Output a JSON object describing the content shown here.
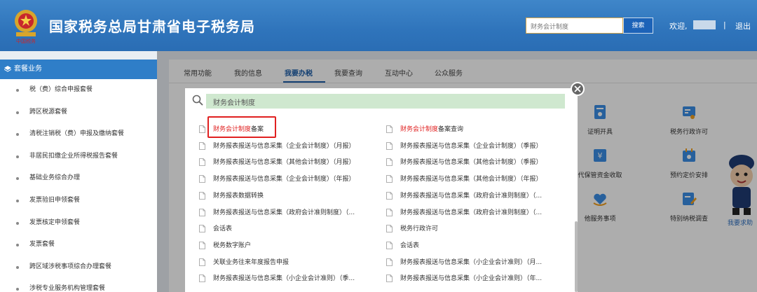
{
  "header": {
    "title": "国家税务总局甘肃省电子税务局",
    "emblem_text": "中国税务",
    "search_value": "财务会计制度",
    "search_button": "搜索",
    "welcome": "欢迎,",
    "separator": "|",
    "logout": "退出"
  },
  "sidebar": {
    "title": "套餐业务",
    "items": [
      "税（费）综合申报套餐",
      "跨区税源套餐",
      "清税注销税（费）申报及缴纳套餐",
      "非居民扣缴企业所得税报告套餐",
      "基础业务综合办理",
      "发票验旧申领套餐",
      "发票核定申领套餐",
      "发票套餐",
      "跨区域涉税事项综合办理套餐",
      "涉税专业服务机构管理套餐"
    ]
  },
  "tabs": [
    "常用功能",
    "我的信息",
    "我要办税",
    "我要查询",
    "互动中心",
    "公众服务"
  ],
  "active_tab": "我要办税",
  "tiles": [
    "证明开具",
    "税务行政许可",
    "代保管资金收取",
    "预约定价安排",
    "他服务事项",
    "特别纳税调查"
  ],
  "help_text": "我要求助",
  "modal": {
    "search_value": "财务会计制度",
    "results_left": [
      {
        "hl": "财务会计制度",
        "rest": "备案"
      },
      {
        "hl": "",
        "rest": "财务报表报送与信息采集（企业会计制度）（月报）"
      },
      {
        "hl": "",
        "rest": "财务报表报送与信息采集（其他会计制度）（月报）"
      },
      {
        "hl": "",
        "rest": "财务报表报送与信息采集（企业会计制度）（年报）"
      },
      {
        "hl": "",
        "rest": "财务报表数据转换"
      },
      {
        "hl": "",
        "rest": "财务报表报送与信息采集（政府会计准则制度）（..."
      },
      {
        "hl": "",
        "rest": "会话表"
      },
      {
        "hl": "",
        "rest": "税务数字账户"
      },
      {
        "hl": "",
        "rest": "关联业务往来年度报告申报"
      },
      {
        "hl": "",
        "rest": "财务报表报送与信息采集（小企业会计准则）（季..."
      }
    ],
    "results_right": [
      {
        "hl": "财务会计制度",
        "rest": "备案查询"
      },
      {
        "hl": "",
        "rest": "财务报表报送与信息采集（企业会计制度）（季报）"
      },
      {
        "hl": "",
        "rest": "财务报表报送与信息采集（其他会计制度）（季报）"
      },
      {
        "hl": "",
        "rest": "财务报表报送与信息采集（其他会计制度）（年报）"
      },
      {
        "hl": "",
        "rest": "财务报表报送与信息采集（政府会计准则制度）（..."
      },
      {
        "hl": "",
        "rest": "财务报表报送与信息采集（政府会计准则制度）（..."
      },
      {
        "hl": "",
        "rest": "税务行政许可"
      },
      {
        "hl": "",
        "rest": "会话表"
      },
      {
        "hl": "",
        "rest": "财务报表报送与信息采集（小企业会计准则）（月..."
      },
      {
        "hl": "",
        "rest": "财务报表报送与信息采集（小企业会计准则）（年..."
      }
    ]
  },
  "colors": {
    "header_blue": "#2f74bb",
    "active_tab": "#1c5ea8",
    "highlight_red": "#e02020",
    "search_green": "#cfe8cf"
  }
}
